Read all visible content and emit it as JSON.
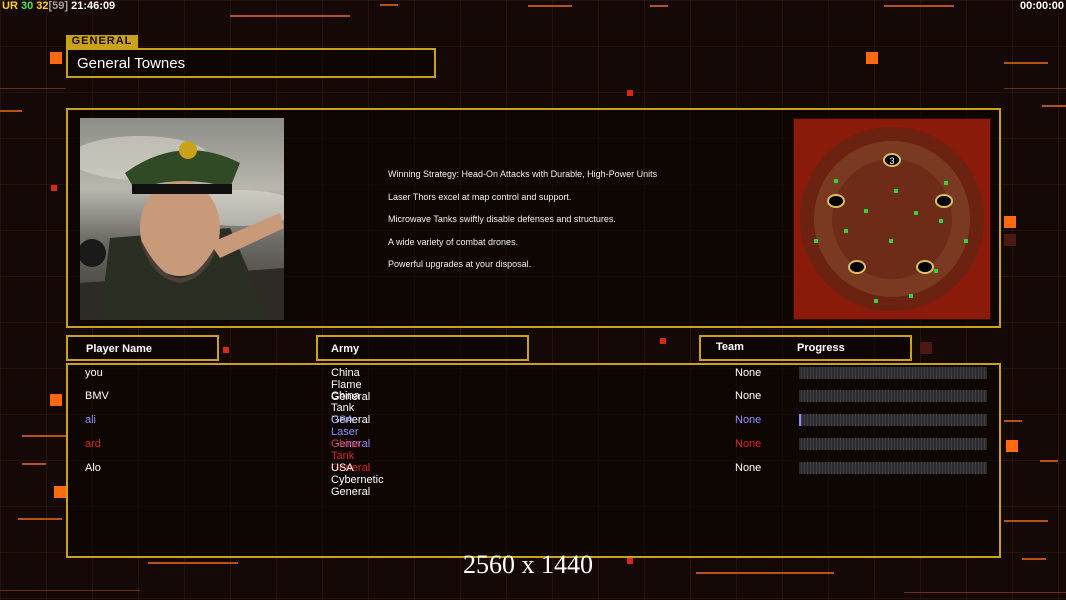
{
  "hud": {
    "ur_label": "UR",
    "ur_value": "30",
    "value2": "32",
    "bracket_value": "[59]",
    "clock": "21:46:09",
    "timer": "00:00:00"
  },
  "general": {
    "tag": "GENERAL",
    "name": "General Townes"
  },
  "strategy_lines": [
    "Winning Strategy: Head-On Attacks with Durable, High-Power Units",
    "Laser Thors excel at map control and support.",
    "Microwave Tanks swiftly disable defenses and structures.",
    "A wide variety of combat drones.",
    "Powerful upgrades at your disposal."
  ],
  "minimap": {
    "start_marker": "3"
  },
  "headers": {
    "player_name": "Player Name",
    "army": "Army",
    "team": "Team",
    "progress": "Progress"
  },
  "players": [
    {
      "name": "you",
      "army": "China Flame General",
      "team": "None",
      "progress": 0,
      "color": "#ffffff"
    },
    {
      "name": "BMV",
      "army": "China Tank General",
      "team": "None",
      "progress": 0,
      "color": "#ffffff"
    },
    {
      "name": "ali",
      "army": "USA Laser General",
      "team": "None",
      "progress": 0.01,
      "color": "#8f8fff"
    },
    {
      "name": "ard",
      "army": "China Tank General",
      "team": "None",
      "progress": 0,
      "color": "#e02424"
    },
    {
      "name": "Alo",
      "army": "USA Cybernetic General",
      "team": "None",
      "progress": 0,
      "color": "#ffffff"
    }
  ],
  "resolution": "2560 x 1440",
  "colors": {
    "frame": "#c9a21a",
    "accent": "#ff6a10",
    "background": "#140906"
  }
}
